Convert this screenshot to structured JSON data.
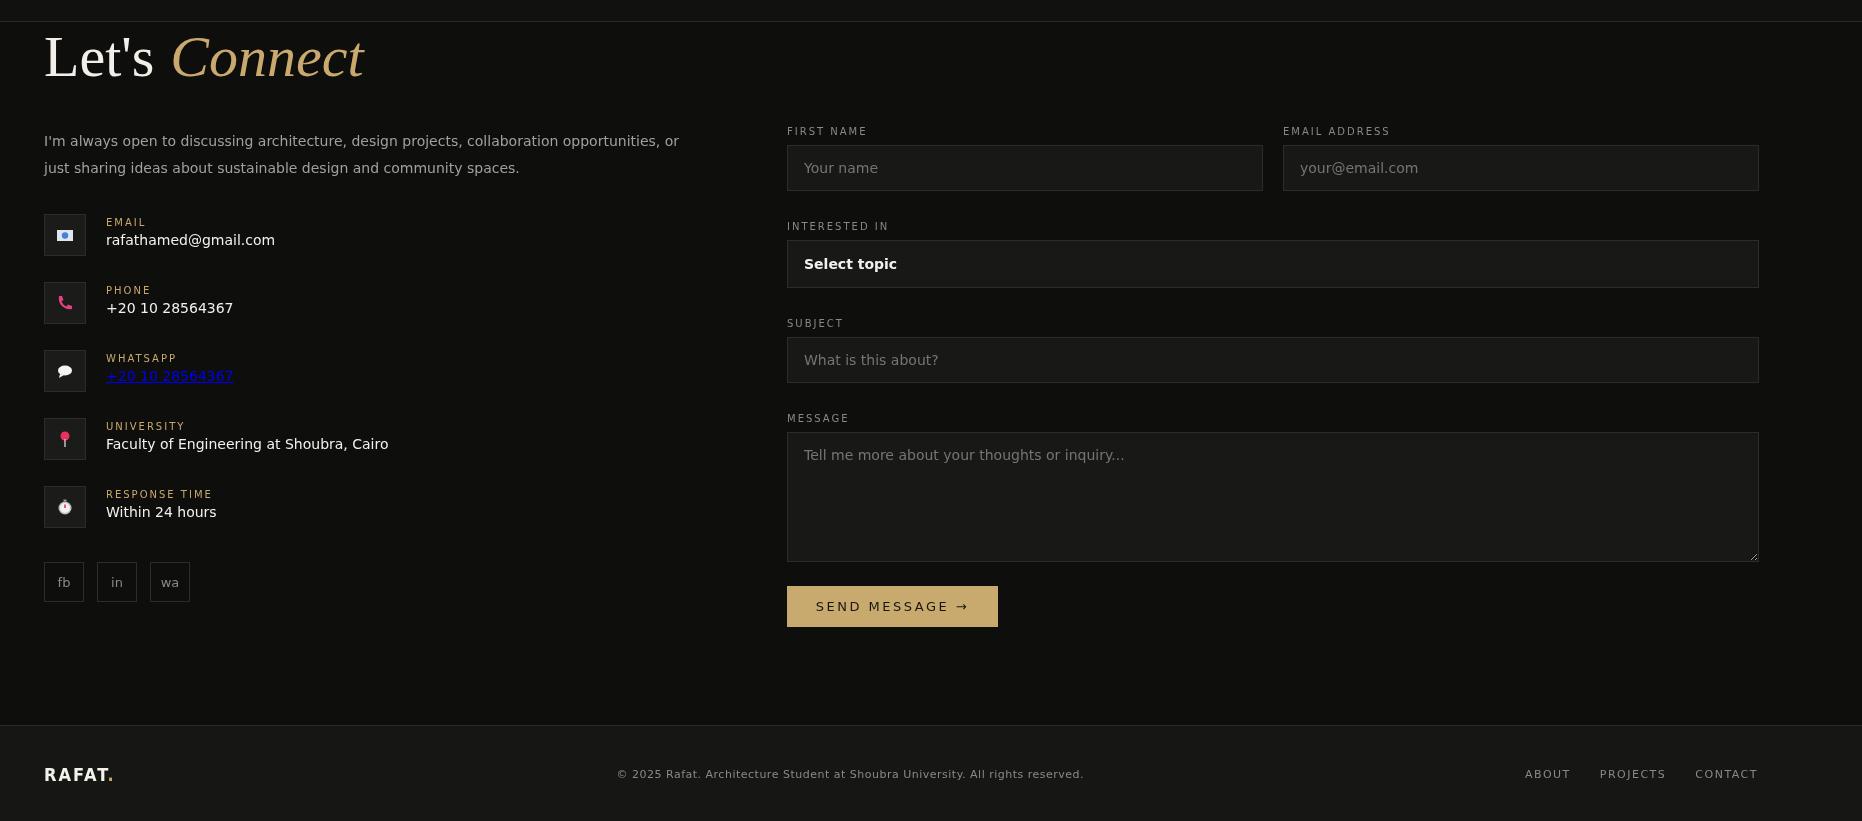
{
  "heading": {
    "lead": "Let's",
    "accent": "Connect"
  },
  "intro": "I'm always open to discussing architecture, design projects, collaboration opportunities, or just sharing ideas about sustainable design and community spaces.",
  "contacts": [
    {
      "kind": "text",
      "label": "EMAIL",
      "value": "rafathamed@gmail.com"
    },
    {
      "kind": "text",
      "label": "PHONE",
      "value": "+20 10 28564367"
    },
    {
      "kind": "link",
      "label": "WHATSAPP",
      "value": "+20 10 28564367"
    },
    {
      "kind": "text",
      "label": "UNIVERSITY",
      "value": "Faculty of Engineering at Shoubra, Cairo"
    },
    {
      "kind": "text",
      "label": "RESPONSE TIME",
      "value": "Within 24 hours"
    }
  ],
  "socials": [
    "fb",
    "in",
    "wa"
  ],
  "form": {
    "fields": [
      {
        "kind": "input",
        "label": "FIRST NAME",
        "placeholder": "Your name",
        "half": true
      },
      {
        "kind": "input",
        "label": "EMAIL ADDRESS",
        "placeholder": "your@email.com",
        "half": true
      },
      {
        "kind": "select",
        "label": "INTERESTED IN",
        "value": "Select topic",
        "half": false
      },
      {
        "kind": "input",
        "label": "SUBJECT",
        "placeholder": "What is this about?",
        "half": false
      },
      {
        "kind": "textarea",
        "label": "MESSAGE",
        "placeholder": "Tell me more about your thoughts or inquiry...",
        "half": false
      }
    ],
    "submit": "SEND MESSAGE →"
  },
  "footer": {
    "logo": "RAFAT",
    "logo_dot": ".",
    "copyright": "© 2025 Rafat. Architecture Student at Shoubra University. All rights reserved.",
    "links": [
      "ABOUT",
      "PROJECTS",
      "CONTACT"
    ]
  }
}
